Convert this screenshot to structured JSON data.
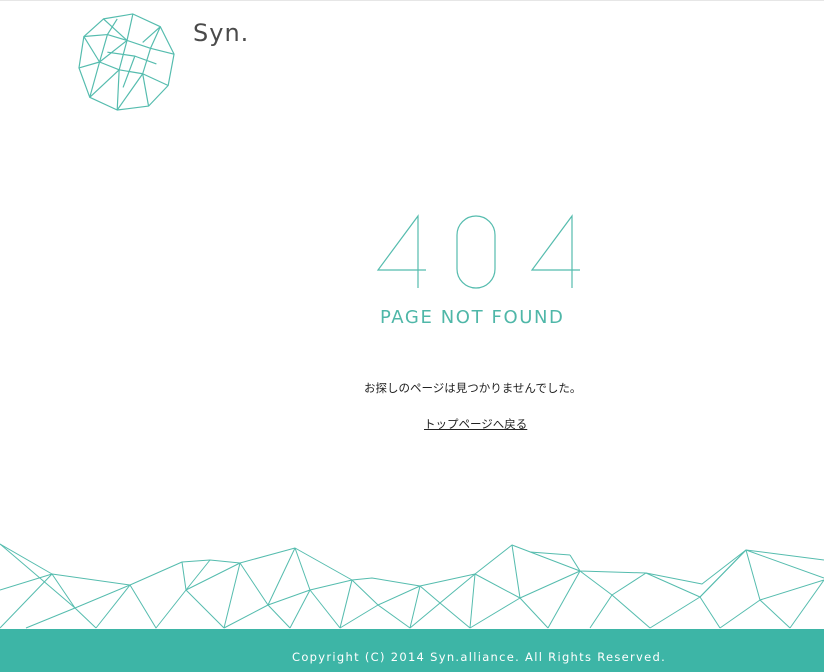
{
  "header": {
    "logo_icon": "geometric-polygon-logo-icon",
    "brand_name": "Syn."
  },
  "error": {
    "code": "404",
    "title": "PAGE NOT FOUND",
    "message": "お探しのページは見つかりませんでした。",
    "home_link": "トップページへ戻る"
  },
  "footer": {
    "decoration": "polygon-mesh-decoration",
    "copyright": "Copyright (C) 2014 Syn.alliance. All Rights Reserved."
  },
  "colors": {
    "accent": "#3db5a6",
    "line": "#55bcae",
    "text": "#222222",
    "brand_text": "#4a4a4a",
    "background": "#ffffff"
  }
}
